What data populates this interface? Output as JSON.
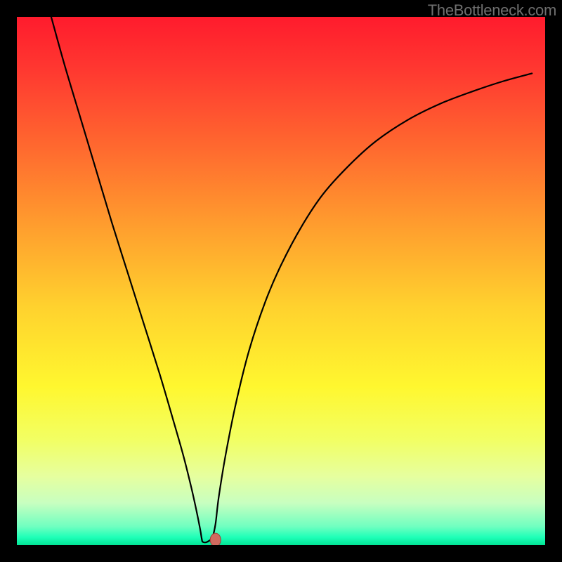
{
  "watermark": "TheBottleneck.com",
  "chart_data": {
    "type": "line",
    "title": "",
    "xlabel": "",
    "ylabel": "",
    "xlim": [
      0,
      100
    ],
    "ylim": [
      0,
      100
    ],
    "grid": false,
    "background_gradient": {
      "stops": [
        {
          "offset": 0.0,
          "color": "#ff1b2d"
        },
        {
          "offset": 0.1,
          "color": "#ff3830"
        },
        {
          "offset": 0.25,
          "color": "#ff6a2f"
        },
        {
          "offset": 0.4,
          "color": "#ff9f2e"
        },
        {
          "offset": 0.55,
          "color": "#ffd22e"
        },
        {
          "offset": 0.7,
          "color": "#fff72f"
        },
        {
          "offset": 0.8,
          "color": "#f2ff63"
        },
        {
          "offset": 0.87,
          "color": "#e6ff9f"
        },
        {
          "offset": 0.92,
          "color": "#c8ffc0"
        },
        {
          "offset": 0.965,
          "color": "#6fffc0"
        },
        {
          "offset": 0.985,
          "color": "#1fffb8"
        },
        {
          "offset": 1.0,
          "color": "#00e494"
        }
      ]
    },
    "frame_color": "#000000",
    "series": [
      {
        "name": "curve",
        "color": "#000000",
        "stroke_width": 2.2,
        "x": [
          6.5,
          9,
          12,
          15,
          18,
          21,
          24,
          27,
          29.5,
          31.5,
          33.0,
          34.0,
          34.7,
          35.0,
          35.2,
          36.0,
          37.0,
          37.6,
          38.2,
          39.5,
          41.5,
          44,
          47,
          50,
          54,
          58,
          63,
          68,
          74,
          80,
          86,
          92,
          97.5
        ],
        "y": [
          100,
          91,
          81,
          71,
          61,
          51.5,
          42,
          32.5,
          24,
          17,
          11,
          6.5,
          3,
          1.2,
          0.6,
          0.6,
          1.5,
          4,
          9,
          17,
          27,
          37,
          46,
          53,
          60.5,
          66.5,
          72,
          76.5,
          80.5,
          83.5,
          85.8,
          87.8,
          89.3
        ]
      }
    ],
    "marker": {
      "x": 37.6,
      "y": 1.0,
      "rx": 1.0,
      "ry": 1.25,
      "fill": "#cf6a5f",
      "stroke": "#9e3f38"
    }
  }
}
